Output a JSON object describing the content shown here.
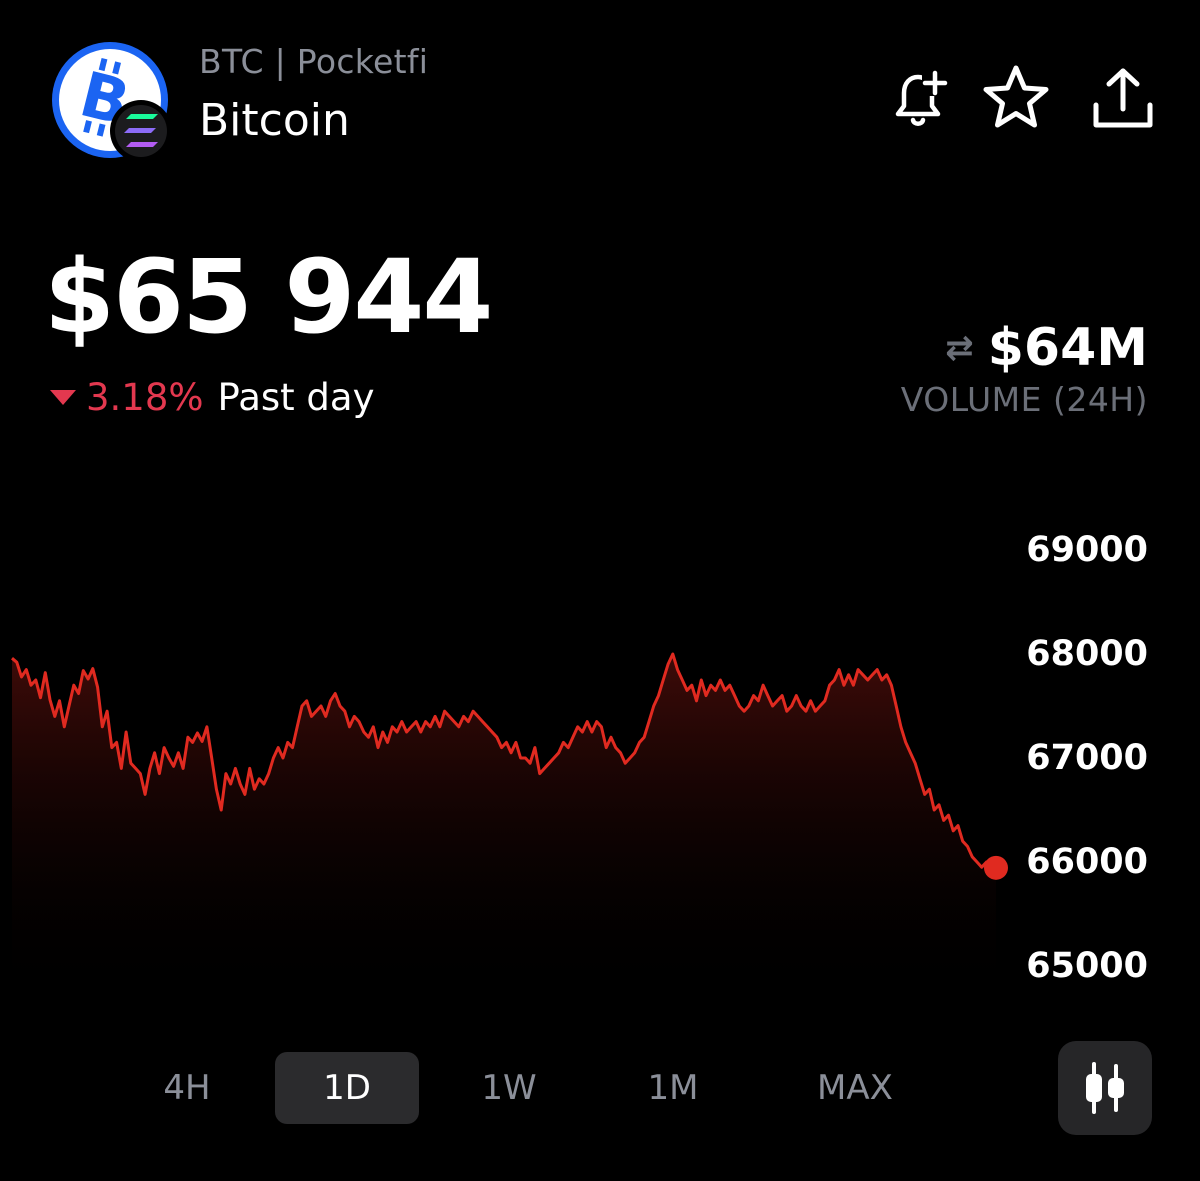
{
  "header": {
    "ticker_line": "BTC | Pocketfi",
    "name": "Bitcoin",
    "icons": [
      "bitcoin-logo-icon",
      "solana-badge-icon",
      "bell-plus-icon",
      "star-icon",
      "share-icon"
    ]
  },
  "price": {
    "value": "$65 944",
    "change_pct": "3.18%",
    "change_period": "Past day",
    "change_direction": "down"
  },
  "volume": {
    "value": "$64M",
    "label": "VOLUME (24H)",
    "icon": "swap-arrows-icon"
  },
  "tabs": [
    {
      "label": "4H",
      "active": false
    },
    {
      "label": "1D",
      "active": true
    },
    {
      "label": "1W",
      "active": false
    },
    {
      "label": "1M",
      "active": false
    },
    {
      "label": "MAX",
      "active": false
    }
  ],
  "candle_button_icon": "candlestick-icon",
  "colors": {
    "accent_down": "#e3384f",
    "line": "#e02a20",
    "brand_blue": "#1b64f2",
    "background": "#000000"
  },
  "chart_data": {
    "type": "line",
    "ylim": [
      64500,
      69500
    ],
    "yticks": [
      "69000",
      "68000",
      "67000",
      "66000",
      "65000"
    ],
    "grid": false,
    "legend": "none",
    "values": [
      67960,
      67920,
      67780,
      67850,
      67700,
      67750,
      67580,
      67820,
      67560,
      67400,
      67550,
      67300,
      67500,
      67700,
      67620,
      67840,
      67760,
      67860,
      67680,
      67300,
      67450,
      67100,
      67150,
      66900,
      67250,
      66950,
      66900,
      66850,
      66650,
      66900,
      67050,
      66850,
      67100,
      67000,
      66920,
      67050,
      66900,
      67200,
      67150,
      67240,
      67160,
      67300,
      67000,
      66700,
      66500,
      66850,
      66750,
      66900,
      66750,
      66650,
      66900,
      66700,
      66800,
      66750,
      66850,
      67000,
      67100,
      67000,
      67150,
      67100,
      67300,
      67500,
      67550,
      67400,
      67450,
      67500,
      67400,
      67550,
      67620,
      67500,
      67450,
      67300,
      67400,
      67350,
      67250,
      67200,
      67300,
      67100,
      67250,
      67150,
      67300,
      67250,
      67350,
      67250,
      67300,
      67350,
      67250,
      67350,
      67300,
      67400,
      67300,
      67450,
      67400,
      67350,
      67300,
      67400,
      67350,
      67450,
      67400,
      67350,
      67300,
      67250,
      67200,
      67100,
      67150,
      67050,
      67150,
      67000,
      67000,
      66950,
      67100,
      66850,
      66900,
      66950,
      67000,
      67050,
      67150,
      67100,
      67200,
      67300,
      67250,
      67350,
      67250,
      67350,
      67300,
      67100,
      67200,
      67100,
      67050,
      66950,
      67000,
      67050,
      67150,
      67200,
      67350,
      67500,
      67600,
      67750,
      67900,
      68000,
      67850,
      67750,
      67650,
      67700,
      67550,
      67750,
      67600,
      67700,
      67650,
      67750,
      67650,
      67700,
      67600,
      67500,
      67450,
      67500,
      67600,
      67550,
      67700,
      67600,
      67500,
      67550,
      67600,
      67450,
      67500,
      67600,
      67500,
      67450,
      67550,
      67450,
      67500,
      67550,
      67700,
      67750,
      67850,
      67700,
      67800,
      67700,
      67850,
      67800,
      67750,
      67800,
      67850,
      67750,
      67800,
      67700,
      67500,
      67300,
      67150,
      67050,
      66950,
      66800,
      66650,
      66700,
      66500,
      66550,
      66400,
      66450,
      66300,
      66350,
      66200,
      66150,
      66050,
      66000,
      65950,
      66000,
      65900,
      65944
    ]
  }
}
